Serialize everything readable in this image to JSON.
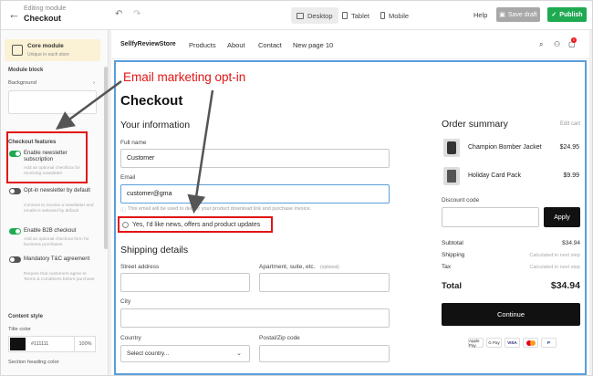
{
  "topbar": {
    "back_icon": "←",
    "subtitle": "Editing module",
    "title": "Checkout",
    "devices": [
      "Desktop",
      "Tablet",
      "Mobile"
    ],
    "help": "Help",
    "save_draft": "Save draft",
    "publish": "Publish"
  },
  "sidebar": {
    "core_module_title": "Core module",
    "core_module_sub": "Unique in each store",
    "module_block": "Module block",
    "background": "Background",
    "checkout_features": "Checkout features",
    "features": [
      {
        "title": "Enable newsletter subscription",
        "desc": "Add an optional checkbox for receiving newsletter",
        "on": true
      },
      {
        "title": "Opt-in newsletter by default",
        "desc": "Consent to receive a newsletter and emails is selected by default",
        "on": false
      },
      {
        "title": "Enable B2B checkout",
        "desc": "Add an optional checkout form for business purchases",
        "on": true
      },
      {
        "title": "Mandatory T&C agreement",
        "desc": "Require that customers agree to Terms & Conditions before purchase",
        "on": false
      }
    ],
    "content_style": "Content style",
    "title_color": "Title color",
    "title_color_hex": "#111111",
    "title_color_opacity": "100%",
    "section_heading_color": "Section heading color"
  },
  "store": {
    "name": "SellfyReviewStore",
    "nav": [
      "Products",
      "About",
      "Contact",
      "New page 10"
    ],
    "cart_count": "0"
  },
  "checkout": {
    "heading": "Checkout",
    "your_information": "Your information",
    "full_name_label": "Full name",
    "full_name_value": "Customer",
    "email_label": "Email",
    "email_value": "customer@gma",
    "email_hint": "This email will be used to deliver your product download link and purchase invoice.",
    "newsletter_label": "Yes, I'd like news, offers and product updates",
    "shipping_details": "Shipping details",
    "street_label": "Street address",
    "apt_label": "Apartment, suite, etc.",
    "apt_optional": "(optional)",
    "city_label": "City",
    "country_label": "Country",
    "country_placeholder": "Select country...",
    "zip_label": "Postal/Zip code"
  },
  "order_summary": {
    "title": "Order summary",
    "edit_cart": "Edit cart",
    "items": [
      {
        "name": "Champion Bomber Jacket",
        "price": "$24.95"
      },
      {
        "name": "Holiday Card Pack",
        "price": "$9.99"
      }
    ],
    "discount_label": "Discount code",
    "apply": "Apply",
    "subtotal_label": "Subtotal",
    "subtotal_value": "$34.94",
    "shipping_label": "Shipping",
    "shipping_value": "Calculated in next step",
    "tax_label": "Tax",
    "tax_value": "Calculated in next step",
    "total_label": "Total",
    "total_value": "$34.94",
    "continue": "Continue",
    "payments": [
      "Apple Pay",
      "G Pay",
      "VISA",
      "Mastercard",
      "PayPal"
    ]
  },
  "annotation": {
    "label": "Email marketing opt-in",
    "color": "#e21414"
  },
  "colors": {
    "publish": "#1faa52",
    "focus": "#5a9fdc"
  }
}
